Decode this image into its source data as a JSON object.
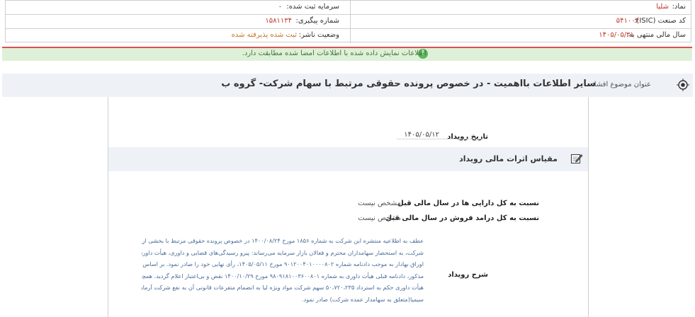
{
  "company_info": {
    "symbol_label": "نماد:",
    "symbol_value": "شلیا",
    "registered_capital_label": "سرمایه ثبت شده:",
    "registered_capital_value": "۰",
    "isic_label": "کد صنعت (ISIC):",
    "isic_value": "۵۴۱۰۰۴",
    "tracking_label": "شماره پیگیری:",
    "tracking_value": "۱۵۸۱۱۳۴",
    "fiscal_year_label": "سال مالی منتهی به:",
    "fiscal_year_value": "۱۴۰۵/۰۵/۳۱",
    "publisher_status_label": "وضعیت ناشر:",
    "publisher_status_value": "ثبت شده پذیرفته شده"
  },
  "banner": {
    "message": "اطلاعات نمایش داده شده با اطلاعات امضا شده مطابقت دارد.",
    "icon": "info-icon",
    "icon_glyph": "i"
  },
  "subject": {
    "label": "عنوان موضوع افشا:",
    "text": "سایر اطلاعات بااهمیت - در خصوص پرونده حقوقی مرتبط با سهام شرکت- گروه ب",
    "icon": "target-icon"
  },
  "event": {
    "date_label": "تاریخ رویداد",
    "date_value": "۱۴۰۵/۰۵/۱۲",
    "section_title": "مقیاس اثرات مالی رویداد",
    "section_icon": "edit-icon",
    "ratio_assets_label": "نسبت به کل دارایی ها در سال مالی قبل",
    "ratio_assets_value": "مشخص نیست",
    "ratio_revenue_label": "نسبت به کل درامد فروش در سال مالی قبل",
    "ratio_revenue_value": "مشخص نیست",
    "description_label": "شرح رویداد",
    "description_lines": [
      "عطف به اطلاعیه منتشره این شرکت به شماره ۱۸۵۶ مورخ ۱۴۰۰/۰۸/۲۴ در خصوص پرونده حقوقی مرتبط با بخشی از سهام",
      "شرکت، به استحضار سهامداران محترم و فعالان بازار سرمایه می‌رساند: پیرو رسیدگی‌های قضایی و داوری، هیأت داوری قانون بازار",
      "اوراق بهادار به موجب دادنامه شماره ۹۰۱۲۰۰۴۰۱۰۰۰۰۸۰۲ مورخ ۱۴۰۵/۰۵/۱۱، رأی نهایی خود را صادر نمود. بر اساس رأی",
      "مذکور، دادنامه قبلی هیأت داوری به شماره ۹۸۰۹۱۸۱۰۰۳۶۰۰۸۰۱ مورخ ۱۴۰۰/۱۰/۲۹ نقض و بی‌اعتبار اعلام گردید. همچنین،",
      "هیأت داوری حکم به استرداد ۵۰،۷۲۰،۲۳۵ سهم شرکت مواد ویژه لیا به انضمام متفرعات قانونی آن به نفع شرکت آرمان آفرینان",
      "سیمیا(متعلق به سهامدار عمده شرکت) صادر نمود."
    ]
  }
}
